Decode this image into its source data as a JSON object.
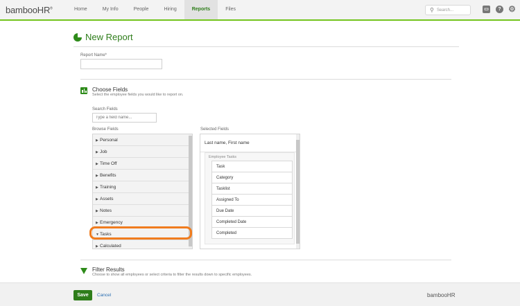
{
  "app": {
    "logo_text": "bambooHR",
    "nav": [
      "Home",
      "My Info",
      "People",
      "Hiring",
      "Reports",
      "Files"
    ],
    "active_nav": "Reports",
    "search_placeholder": "Search..."
  },
  "page": {
    "title": "New Report"
  },
  "report_name": {
    "label": "Report Name*",
    "value": ""
  },
  "choose_fields": {
    "title": "Choose Fields",
    "description": "Select the employee fields you would like to report on.",
    "search_label": "Search Fields",
    "search_placeholder": "Type a field name...",
    "browse_label": "Browse Fields",
    "selected_label": "Selected Fields",
    "browse_items": [
      "Personal",
      "Job",
      "Time Off",
      "Benefits",
      "Training",
      "Assets",
      "Notes",
      "Emergency",
      "Tasks",
      "Calculated"
    ],
    "expanded_item": "Tasks",
    "selected_header": "Last name, First name",
    "selected_group": "Employee Tasks",
    "selected_items": [
      "Task",
      "Category",
      "Tasklist",
      "Assigned To",
      "Due Date",
      "Completed Date",
      "Completed"
    ]
  },
  "filter": {
    "title": "Filter Results",
    "description": "Choose to show all employees or select criteria to filter the results down to specific employees."
  },
  "footer": {
    "save_label": "Save",
    "cancel_label": "Cancel",
    "logo_text": "bambooHR"
  },
  "colors": {
    "brand_green": "#2e7d1a",
    "accent_lime": "#73c41d",
    "highlight_orange": "#f07c1e",
    "link_blue": "#2b6fb3"
  }
}
